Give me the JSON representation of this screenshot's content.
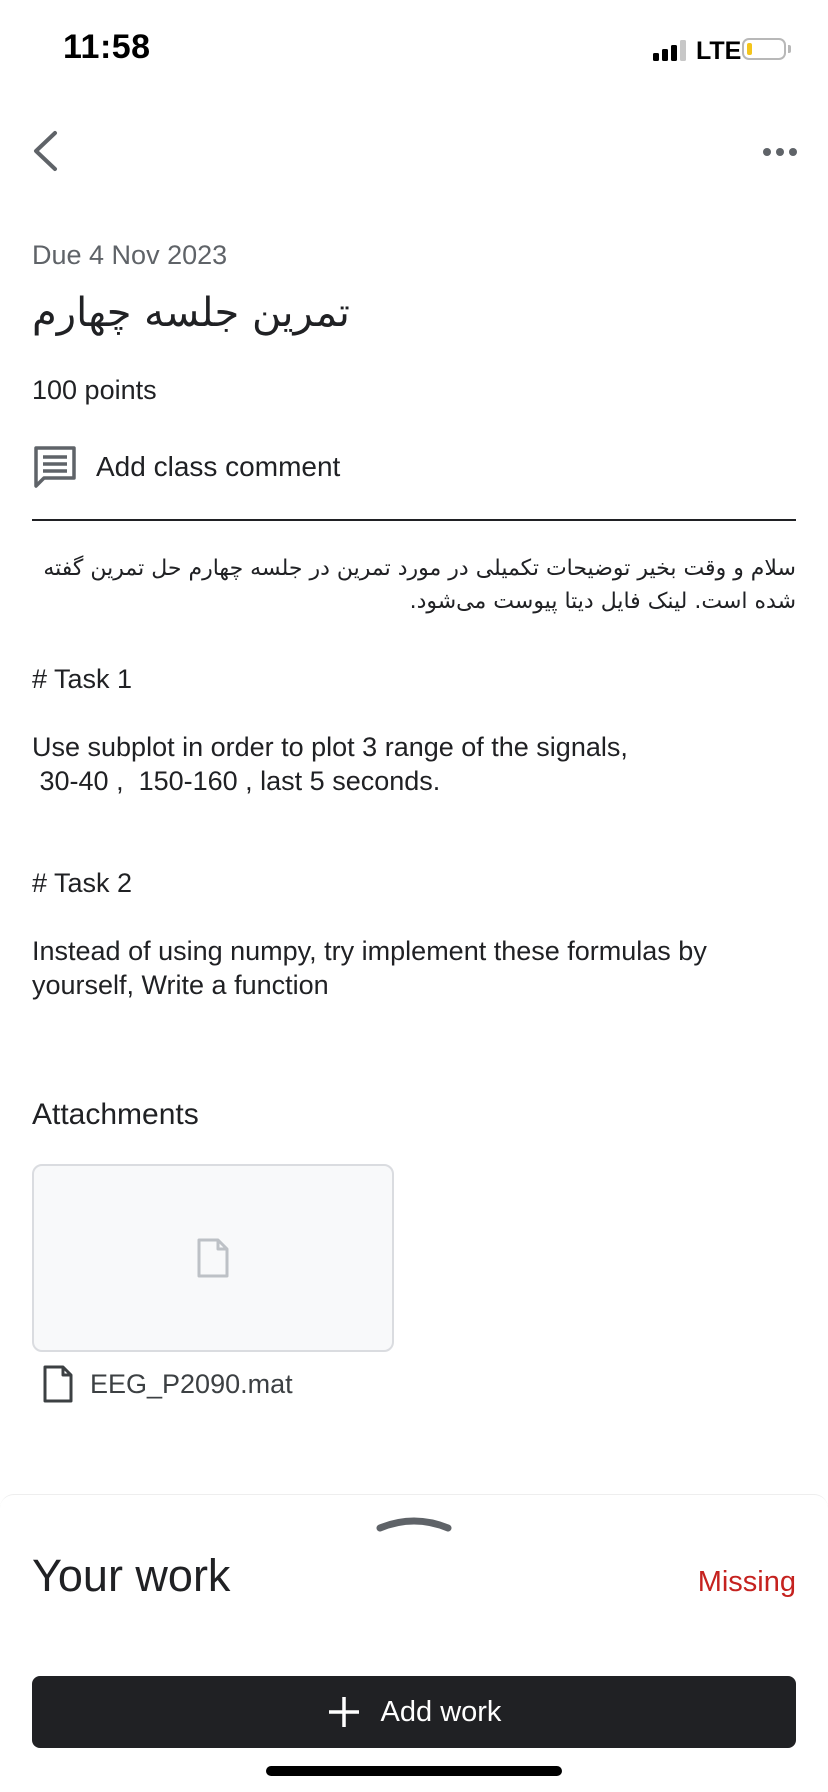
{
  "status_bar": {
    "time": "11:58",
    "network": "LTE",
    "battery_level": 0.15,
    "battery_color": "#f4c51c"
  },
  "app_bar": {
    "back_icon": "chevron-left-icon",
    "more_icon": "more-horizontal-icon"
  },
  "assignment": {
    "due": "Due 4 Nov 2023",
    "title": "تمرین جلسه چهارم",
    "points": "100 points",
    "add_comment_label": "Add class comment"
  },
  "description": {
    "persian_text": "سلام و وقت بخیر توضیحات تکمیلی در مورد تمرین در جلسه چهارم حل تمرین گفته شده است. لینک فایل دیتا پیوست می‌شود.",
    "task1_heading": "# Task 1",
    "task1_body": "Use subplot in order to plot 3 range of the signals,\n 30-40 ,  150-160 , last 5 seconds.",
    "task2_heading": "# Task 2",
    "task2_body": "Instead of using numpy, try implement these formulas by yourself, Write a function"
  },
  "attachments": {
    "title": "Attachments",
    "files": [
      {
        "name": "EEG_P2090.mat",
        "icon": "file-icon"
      }
    ]
  },
  "your_work": {
    "title": "Your work",
    "status": "Missing",
    "status_color": "#c5221f",
    "add_work_label": "Add work"
  }
}
